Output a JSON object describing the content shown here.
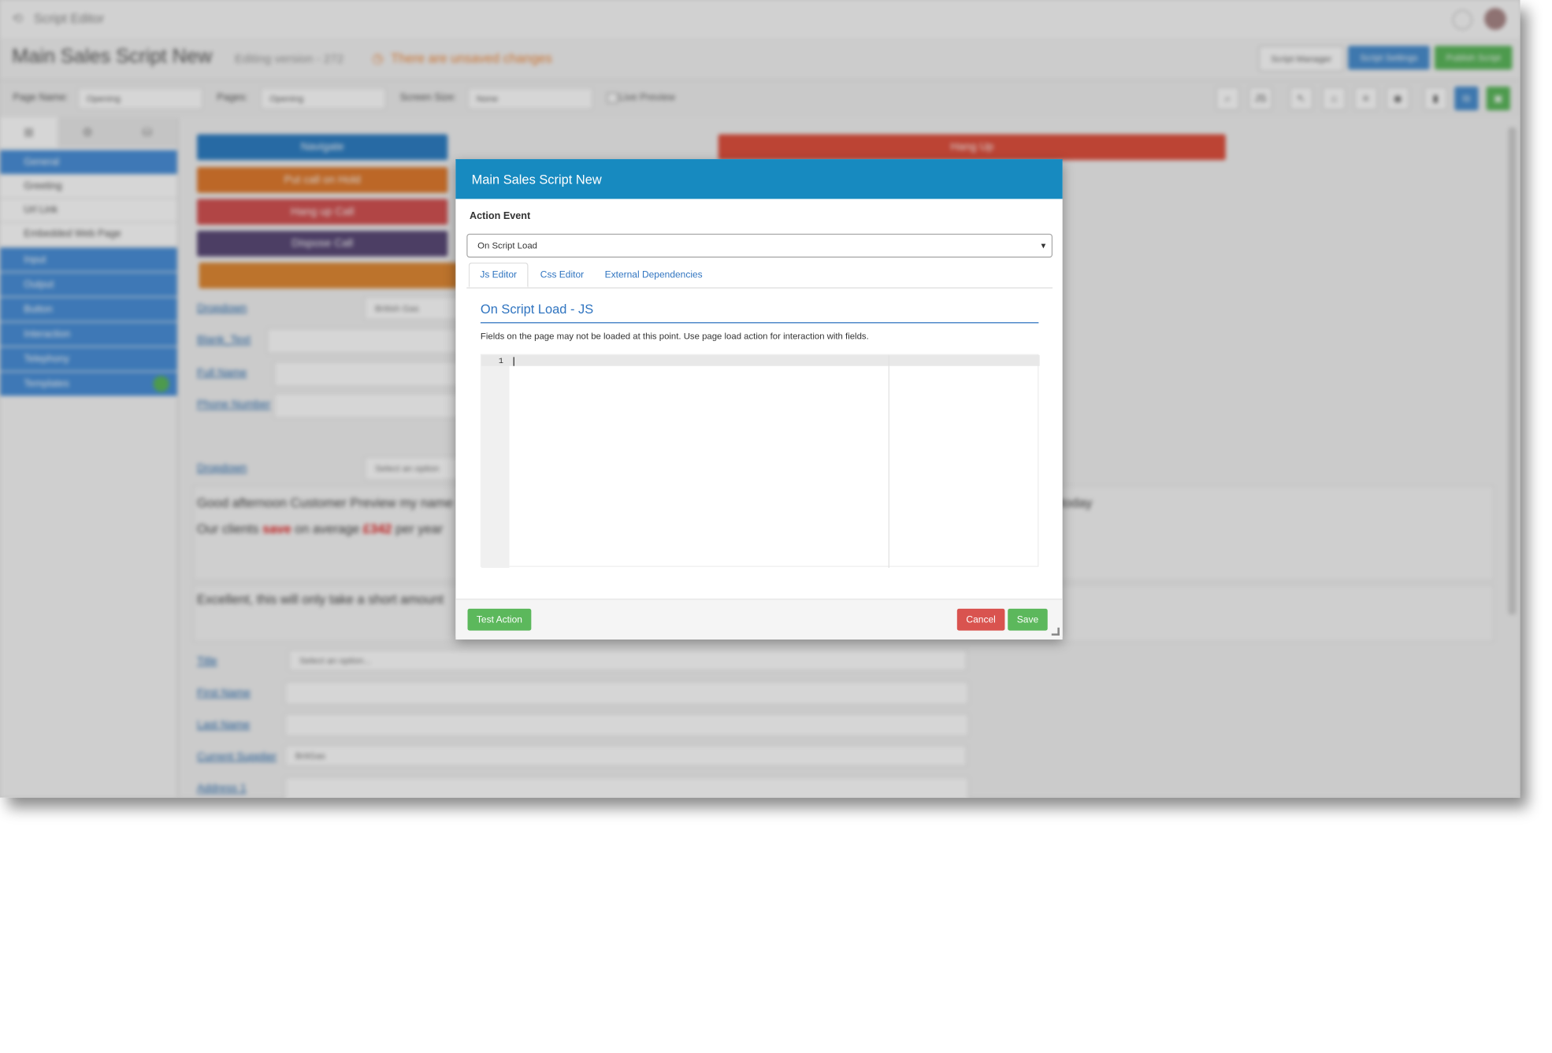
{
  "app": {
    "title": "Script Editor"
  },
  "script": {
    "name": "Main Sales Script New",
    "version_text": "Editing version - 272",
    "unsaved_text": "There are unsaved changes"
  },
  "header_buttons": {
    "manager": "Script Manager",
    "settings": "Script Settings",
    "publish": "Publish Script"
  },
  "toolbar": {
    "page_name_label": "Page Name:",
    "page_name_value": "Opening",
    "pages_label": "Pages:",
    "pages_value": "Opening",
    "screen_size_label": "Screen Size:",
    "screen_size_value": "None",
    "live_preview_label": "Live Preview",
    "js_label": "JS"
  },
  "sidebar": {
    "general": "General",
    "items": [
      "Greeting",
      "Url Link",
      "Embedded Web Page"
    ],
    "groups": [
      "Input",
      "Output",
      "Button",
      "Interaction",
      "Telephony",
      "Templates"
    ]
  },
  "canvas": {
    "buttons": {
      "navigate": "Navigate",
      "hold": "Put call on Hold",
      "hangup_call": "Hang up Call",
      "dispose": "Dispose Call",
      "hangup": "Hang Up"
    },
    "fields": [
      {
        "label": "Dropdown",
        "value": "British Gas"
      },
      {
        "label": "Blank_Text",
        "value": ""
      },
      {
        "label": "Full Name",
        "value": ""
      },
      {
        "label": "Phone Number",
        "value": ""
      },
      {
        "label": "Dropdown",
        "value": "Select an option"
      }
    ],
    "paragraph1": "Good afternoon Customer Preview my name",
    "paragraph1_tail": "today",
    "paragraph2_a": "Our clients",
    "paragraph2_save": "save",
    "paragraph2_b": "on average",
    "paragraph2_amount": "£342",
    "paragraph2_c": "per year",
    "paragraph3": "Excellent, this will only take a short amount",
    "form_fields": [
      {
        "label": "Title",
        "value": "Select an option..."
      },
      {
        "label": "First Name",
        "value": ""
      },
      {
        "label": "Last Name",
        "value": ""
      },
      {
        "label": "Current Supplier",
        "value": "BritGas"
      },
      {
        "label": "Address 1",
        "value": ""
      }
    ]
  },
  "modal": {
    "title": "Main Sales Script New",
    "action_event_label": "Action Event",
    "action_event_value": "On Script Load",
    "tabs": [
      "Js Editor",
      "Css Editor",
      "External Dependencies"
    ],
    "active_tab": "Js Editor",
    "section_title": "On Script Load - JS",
    "note": "Fields on the page may not be loaded at this point. Use page load action for interaction with fields.",
    "line_number": "1",
    "buttons": {
      "test": "Test Action",
      "cancel": "Cancel",
      "save": "Save"
    }
  },
  "colors": {
    "modal_header": "#178ac0",
    "primary_link": "#2f74c0",
    "success": "#5cb85c",
    "danger": "#d9534f"
  }
}
